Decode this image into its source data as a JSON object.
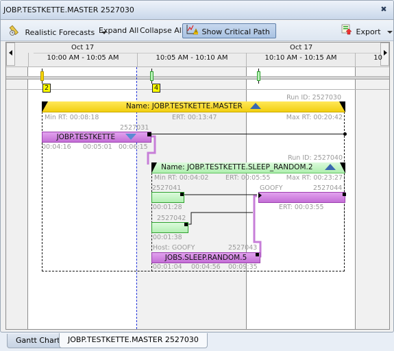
{
  "window": {
    "title": "JOBP.TESTKETTE.MASTER 2527030",
    "close_icon": "close-icon"
  },
  "toolbar": {
    "forecasts_label": "Realistic Forecasts",
    "expand_label": "Expand All",
    "collapse_label": "Collapse All",
    "critical_path_label": "Show Critical Path",
    "export_label": "Export"
  },
  "timeline": {
    "dates": [
      "Oct 17",
      "Oct 17"
    ],
    "ranges": [
      "10:00 AM - 10:05 AM",
      "10:05 AM - 10:10 AM",
      "10:10 AM - 10:15 AM",
      "10"
    ],
    "markers": [
      {
        "label": "2",
        "color": "#f5d400"
      },
      {
        "label": "4",
        "color": "#9ce89c"
      },
      {
        "label": "",
        "color": "#9ce89c"
      }
    ]
  },
  "master": {
    "run_id": "Run ID: 2527030",
    "name": "Name: JOBP.TESTKETTE.MASTER",
    "min_rt": "Min RT: 00:08:18",
    "ert": "ERT: 00:13:47",
    "max_rt": "Max RT: 00:20:42",
    "color": "#f7d51d"
  },
  "testkette": {
    "run_id": "2527031",
    "name": "JOBP.TESTKETTE",
    "times": [
      "00:04:16",
      "00:05:01",
      "00:06:15"
    ]
  },
  "sleep_random": {
    "run_id": "Run ID: 2527040",
    "name": "Name: JOBP.TESTKETTE.SLEEP_RANDOM.2",
    "min_rt": "Min RT: 00:04:02",
    "ert": "ERT: 00:05:55",
    "max_rt": "Max RT: 00:23:27"
  },
  "tasks": [
    {
      "id": "2527041",
      "time": "00:01:28"
    },
    {
      "id": "2527042",
      "time": "00:01:38"
    },
    {
      "id": "2527043",
      "host": "Host: GOOFY",
      "name": "JOBS.SLEEP.RANDOM.5",
      "times": [
        "00:01:04",
        "00:04:56",
        "00:09:35"
      ]
    },
    {
      "id": "2527044",
      "host": "GOOFY",
      "ert": "ERT: 00:03:55"
    }
  ],
  "tabs": [
    {
      "label": "Gantt Chart",
      "active": false
    },
    {
      "label": "JOBP.TESTKETTE.MASTER 2527030",
      "active": true
    }
  ]
}
